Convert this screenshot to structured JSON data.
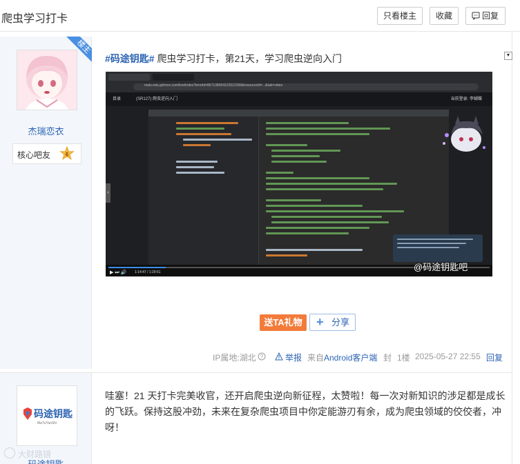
{
  "header": {
    "title": "爬虫学习打卡",
    "buttons": {
      "only_op": "只看楼主",
      "favorite": "收藏",
      "reply": "回复"
    }
  },
  "post1": {
    "user": {
      "ribbon": "楼主",
      "name": "杰瑞恋衣",
      "badge_label": "核心吧友",
      "level": "6"
    },
    "tag": "#码途钥匙#",
    "text": " 爬虫学习打卡，第21天，学习爬虫逆向入门",
    "video": {
      "url_text": "malu.edu.gzhnce.com/live/index?termId=867138004222522258&resourceId=...&tab=video",
      "nav_left": "目录",
      "nav_title": "(SR127) 爬虫逆向入门",
      "nav_right": "当前登录: 李蝴蝶",
      "time": "1:14:47 / 1:29:51",
      "watermark": "@码途钥匙吧"
    },
    "gift_label": "送TA礼物",
    "share_label": "分享",
    "meta": {
      "ip": "IP属地:湖北",
      "report": "举报",
      "from_prefix": "来自",
      "from_client": "Android客户端",
      "seal": "封",
      "floor": "1楼",
      "time": "2025-05-27 22:55",
      "reply": "回复"
    }
  },
  "post2": {
    "user": {
      "logo_title": "码途钥匙",
      "logo_sub": "MaTuYaoShi",
      "name": "码途钥匙"
    },
    "text": "哇塞！21 天打卡完美收官，还开启爬虫逆向新征程，太赞啦！每一次对新知识的涉足都是成长的飞跃。保持这股冲劲，未来在复杂爬虫项目中你定能游刃有余，成为爬虫领域的佼佼者，冲呀！"
  },
  "footer": {
    "watermark": "大财路镜"
  },
  "colors": {
    "link": "#2d64b3",
    "gift": "#f37b3a",
    "sidebar": "#f3f6fb"
  }
}
